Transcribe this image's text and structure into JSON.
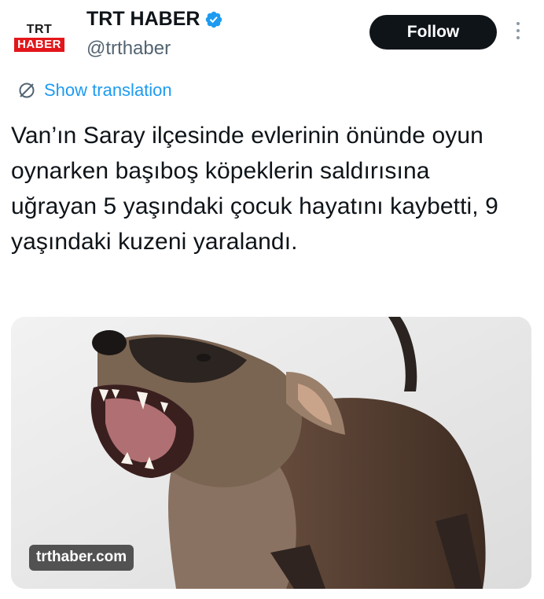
{
  "account": {
    "avatar_top": "TRT",
    "avatar_bottom": "HABER",
    "display_name": "TRT HABER",
    "handle": "@trthaber",
    "verified_icon": "verified-check-icon",
    "verified_color": "#1d9bf0"
  },
  "actions": {
    "follow_label": "Follow",
    "more_icon": "more-vertical-icon"
  },
  "translation": {
    "label": "Show translation",
    "icon": "translate-globe-icon",
    "color": "#1d9bf0"
  },
  "tweet": {
    "text": "Van’ın Saray ilçesinde evlerinin önünde oyun oynarken başıboş köpeklerin saldırısına uğrayan 5 yaşındaki çocuk hayatını kaybetti, 9 yaşındaki kuzeni yaralandı."
  },
  "media": {
    "source_badge": "trthaber.com"
  }
}
